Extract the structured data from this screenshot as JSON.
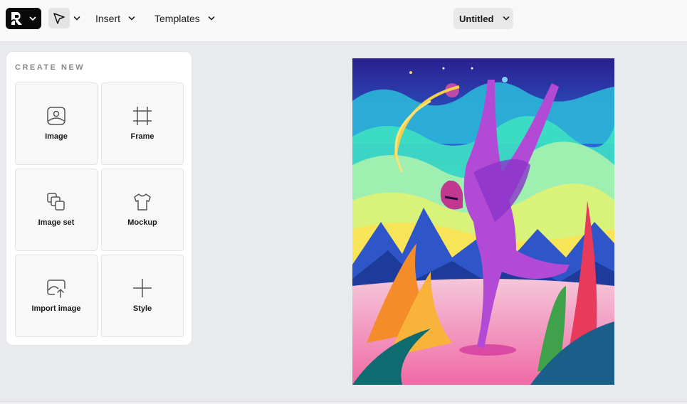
{
  "toolbar": {
    "logo_letter": "R",
    "insert_label": "Insert",
    "templates_label": "Templates",
    "doc_title": "Untitled"
  },
  "panel": {
    "title": "CREATE NEW",
    "tiles": [
      {
        "label": "Image",
        "icon": "image-icon"
      },
      {
        "label": "Frame",
        "icon": "frame-icon"
      },
      {
        "label": "Image set",
        "icon": "image-set-icon"
      },
      {
        "label": "Mockup",
        "icon": "tshirt-icon"
      },
      {
        "label": "Import image",
        "icon": "import-image-icon"
      },
      {
        "label": "Style",
        "icon": "plus-icon"
      }
    ]
  },
  "canvas": {
    "artwork": "colorful-alien-dancer-illustration"
  },
  "colors": {
    "accent_dark": "#0a0a0a",
    "background": "#e9eaed"
  }
}
